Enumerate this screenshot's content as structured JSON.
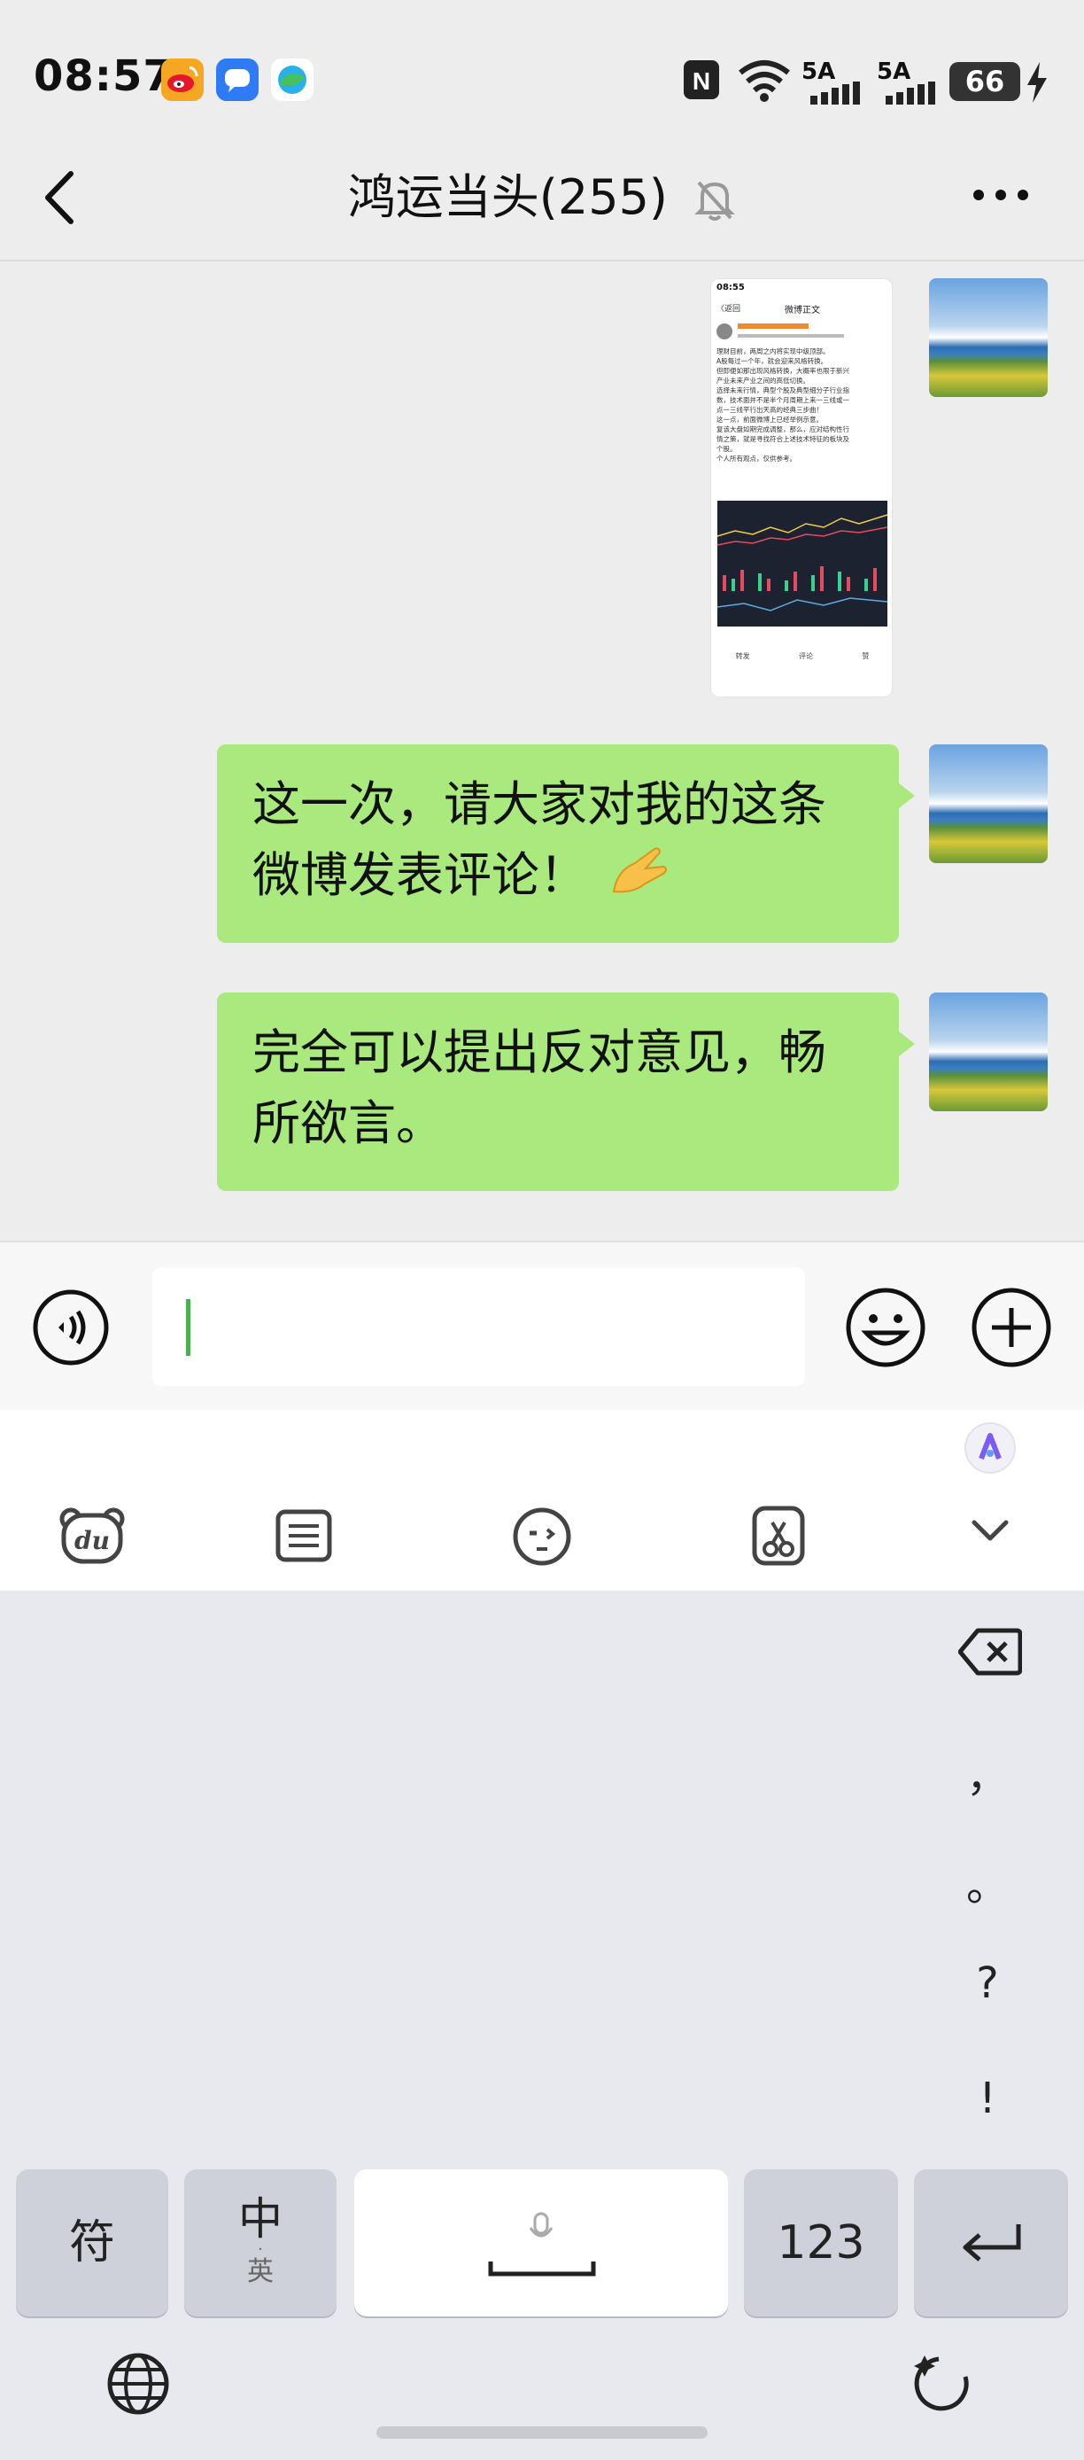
{
  "status_bar": {
    "time": "08:57",
    "net_1": "5A",
    "net_2": "5A",
    "battery": "66"
  },
  "header": {
    "title": "鸿运当头(255)"
  },
  "messages": [
    {
      "type": "image",
      "preview": {
        "time": "08:55",
        "back": "〈返回",
        "title": "微博正文",
        "lines": [
          "理财目前，两周之内将实现中级顶部。",
          "A股每过一个年，就会迎来风格转换。",
          "但即便如那出现风格转换，大概率也限于新兴",
          "产业未来产业之间的高低切换。",
          "选择未来行情，典型个股及典型细分子行业指",
          "数，技术面并不是半个月周期上来一三线或一",
          "点一三线平行出天高的经典三步曲！",
          "这一点，前面微博上已经举例示意。",
          "复该大盘如期完成调整，那么，应对结构性行",
          "情之策，就是寻找符合上述技术特征的板块及",
          "个股。",
          "个人所有观点，仅供参考。"
        ],
        "actions": [
          "转发",
          "评论",
          "赞"
        ]
      }
    },
    {
      "type": "text",
      "text_line1": "这一次，请大家对我的这条",
      "text_line2": "微博发表评论！"
    },
    {
      "type": "text",
      "text_line1": "完全可以提出反对意见，畅",
      "text_line2": "所欲言。"
    }
  ],
  "keyboard": {
    "punctuation": [
      "，",
      "。",
      "?",
      "!"
    ],
    "keys": {
      "symbol": "符",
      "chinese": "中",
      "english_sub": "英",
      "numbers": "123"
    }
  },
  "colors": {
    "bubble": "#a9e97d",
    "background": "#ededed",
    "keyboard_bg": "#e8e9ef",
    "caret": "#4bb04f"
  }
}
